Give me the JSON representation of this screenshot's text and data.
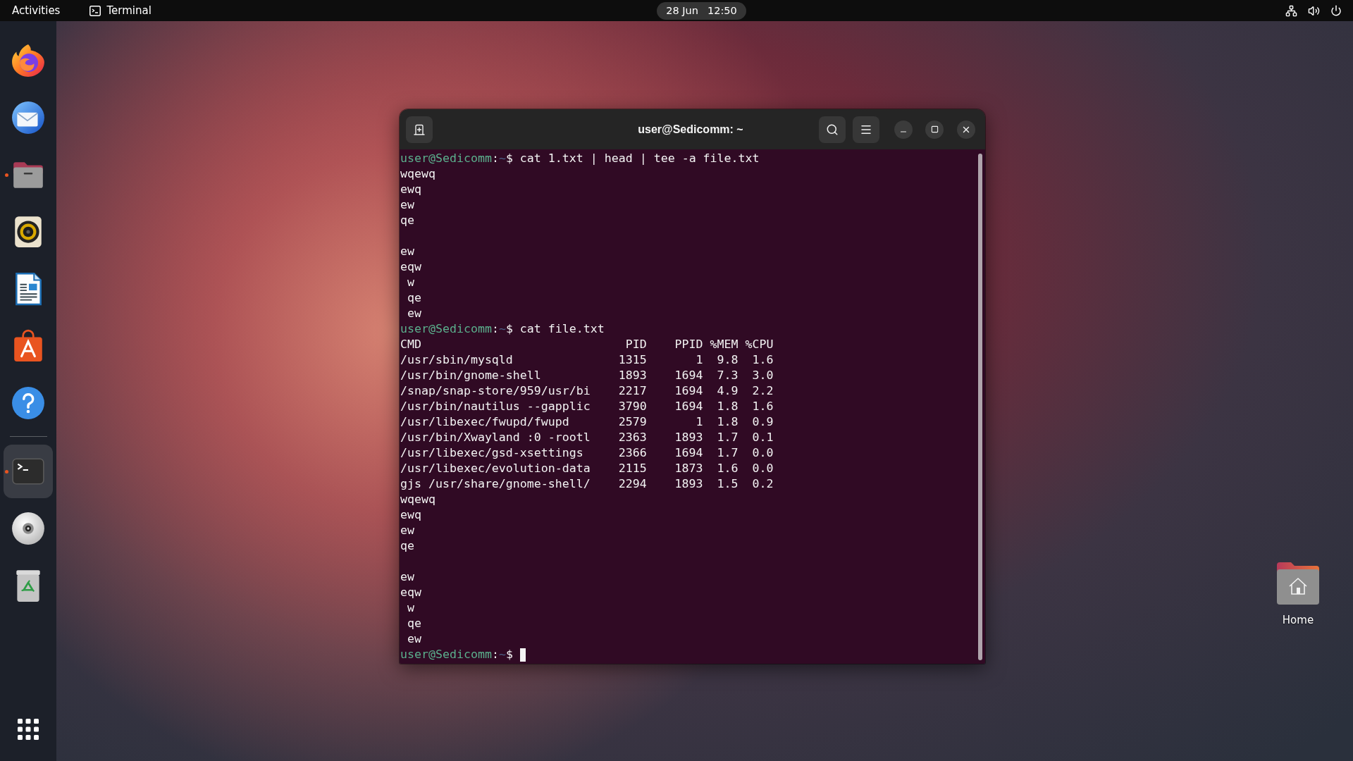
{
  "top_bar": {
    "activities": "Activities",
    "app_menu": "Terminal",
    "clock": {
      "date": "28 Jun",
      "time": "12:50"
    }
  },
  "dock": {
    "favorites": [
      {
        "kind": "browser",
        "running": false,
        "selected": false
      },
      {
        "kind": "mail",
        "running": false,
        "selected": false
      },
      {
        "kind": "files",
        "running": true,
        "selected": false
      },
      {
        "kind": "music",
        "running": false,
        "selected": false
      },
      {
        "kind": "document",
        "running": false,
        "selected": false
      },
      {
        "kind": "store",
        "running": false,
        "selected": false
      },
      {
        "kind": "help",
        "running": false,
        "selected": false
      }
    ],
    "others": [
      {
        "kind": "terminal",
        "running": true,
        "selected": true
      },
      {
        "kind": "disc",
        "running": false,
        "selected": false
      },
      {
        "kind": "trash",
        "running": false,
        "selected": false
      }
    ]
  },
  "terminal_window": {
    "title": "user@Sedicomm: ~",
    "lines": [
      {
        "kind": "prompt",
        "host": "user@Sedicomm",
        "colon": ":",
        "path": "~",
        "sign": "$",
        "command": "cat 1.txt | head | tee -a file.txt",
        "cursor": false
      },
      {
        "kind": "output",
        "text": "wqewq"
      },
      {
        "kind": "output",
        "text": "ewq"
      },
      {
        "kind": "output",
        "text": "ew"
      },
      {
        "kind": "output",
        "text": "qe"
      },
      {
        "kind": "blank"
      },
      {
        "kind": "output",
        "text": "ew"
      },
      {
        "kind": "output",
        "text": "eqw"
      },
      {
        "kind": "output",
        "text": " w"
      },
      {
        "kind": "output",
        "text": " qe"
      },
      {
        "kind": "output",
        "text": " ew"
      },
      {
        "kind": "prompt",
        "host": "user@Sedicomm",
        "colon": ":",
        "path": "~",
        "sign": "$",
        "command": "cat file.txt",
        "cursor": false
      },
      {
        "kind": "table_header",
        "cells": [
          "CMD",
          "PID",
          "PPID",
          "%MEM",
          "%CPU"
        ]
      },
      {
        "kind": "table_row",
        "cells": [
          "/usr/sbin/mysqld",
          "1315",
          "1",
          "9.8",
          "1.6"
        ]
      },
      {
        "kind": "table_row",
        "cells": [
          "/usr/bin/gnome-shell",
          "1893",
          "1694",
          "7.3",
          "3.0"
        ]
      },
      {
        "kind": "table_row",
        "cells": [
          "/snap/snap-store/959/usr/bi",
          "2217",
          "1694",
          "4.9",
          "2.2"
        ]
      },
      {
        "kind": "table_row",
        "cells": [
          "/usr/bin/nautilus --gapplic",
          "3790",
          "1694",
          "1.8",
          "1.6"
        ]
      },
      {
        "kind": "table_row",
        "cells": [
          "/usr/libexec/fwupd/fwupd",
          "2579",
          "1",
          "1.8",
          "0.9"
        ]
      },
      {
        "kind": "table_row",
        "cells": [
          "/usr/bin/Xwayland :0 -rootl",
          "2363",
          "1893",
          "1.7",
          "0.1"
        ]
      },
      {
        "kind": "table_row",
        "cells": [
          "/usr/libexec/gsd-xsettings",
          "2366",
          "1694",
          "1.7",
          "0.0"
        ]
      },
      {
        "kind": "table_row",
        "cells": [
          "/usr/libexec/evolution-data",
          "2115",
          "1873",
          "1.6",
          "0.0"
        ]
      },
      {
        "kind": "table_row",
        "cells": [
          "gjs /usr/share/gnome-shell/",
          "2294",
          "1893",
          "1.5",
          "0.2"
        ]
      },
      {
        "kind": "output",
        "text": "wqewq"
      },
      {
        "kind": "output",
        "text": "ewq"
      },
      {
        "kind": "output",
        "text": "ew"
      },
      {
        "kind": "output",
        "text": "qe"
      },
      {
        "kind": "blank"
      },
      {
        "kind": "output",
        "text": "ew"
      },
      {
        "kind": "output",
        "text": "eqw"
      },
      {
        "kind": "output",
        "text": " w"
      },
      {
        "kind": "output",
        "text": " qe"
      },
      {
        "kind": "output",
        "text": " ew"
      },
      {
        "kind": "prompt",
        "host": "user@Sedicomm",
        "colon": ":",
        "path": "~",
        "sign": "$",
        "cursor": true
      }
    ]
  },
  "desktop_icons": [
    {
      "label": "Home"
    }
  ]
}
